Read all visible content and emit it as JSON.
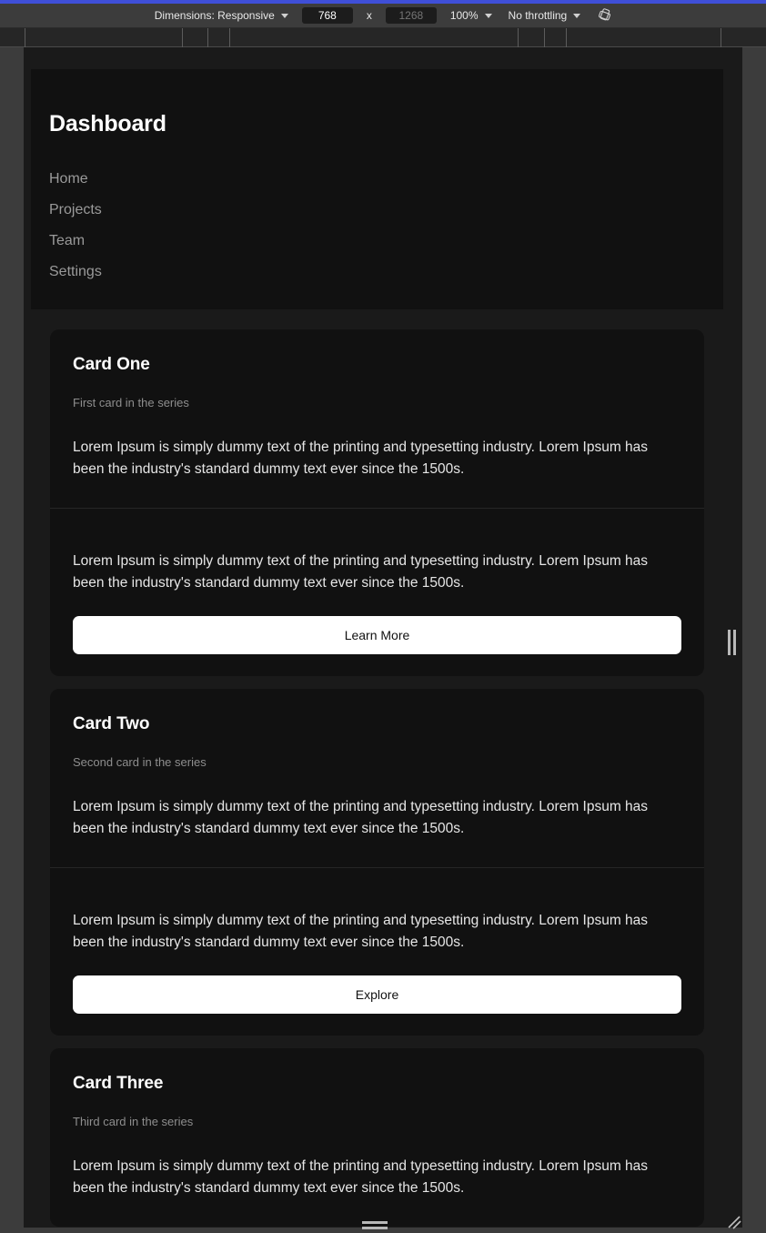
{
  "devtools_toolbar": {
    "dimensions_label": "Dimensions: Responsive",
    "width_value": "768",
    "height_placeholder": "1268",
    "multiply_symbol": "x",
    "zoom_label": "100%",
    "throttling_label": "No throttling",
    "rotate_icon_name": "rotate-device-icon"
  },
  "page": {
    "header": {
      "title": "Dashboard",
      "nav": [
        {
          "label": "Home"
        },
        {
          "label": "Projects"
        },
        {
          "label": "Team"
        },
        {
          "label": "Settings"
        }
      ]
    },
    "cards": [
      {
        "title": "Card One",
        "subtitle": "First card in the series",
        "body": "Lorem Ipsum is simply dummy text of the printing and typesetting industry. Lorem Ipsum has been the industry's standard dummy text ever since the 1500s.",
        "footer_body": "Lorem Ipsum is simply dummy text of the printing and typesetting industry. Lorem Ipsum has been the industry's standard dummy text ever since the 1500s.",
        "button": "Learn More"
      },
      {
        "title": "Card Two",
        "subtitle": "Second card in the series",
        "body": "Lorem Ipsum is simply dummy text of the printing and typesetting industry. Lorem Ipsum has been the industry's standard dummy text ever since the 1500s.",
        "footer_body": "Lorem Ipsum is simply dummy text of the printing and typesetting industry. Lorem Ipsum has been the industry's standard dummy text ever since the 1500s.",
        "button": "Explore"
      },
      {
        "title": "Card Three",
        "subtitle": "Third card in the series",
        "body": "Lorem Ipsum is simply dummy text of the printing and typesetting industry. Lorem Ipsum has been the industry's standard dummy text ever since the 1500s.",
        "footer_body": "",
        "button": ""
      }
    ]
  },
  "colors": {
    "accent_bar": "#3f4fd8",
    "toolbar_bg": "#3c3c3c",
    "ruler_bg": "#262626",
    "page_bg": "#1a1a1a",
    "card_bg": "#111111",
    "button_bg": "#ffffff",
    "title_text": "#ffffff",
    "muted_text": "#8e8e8e",
    "nav_text": "#9a9a9a"
  },
  "ruler_ticks": [
    27,
    200,
    228,
    252,
    569,
    598,
    622,
    792
  ]
}
